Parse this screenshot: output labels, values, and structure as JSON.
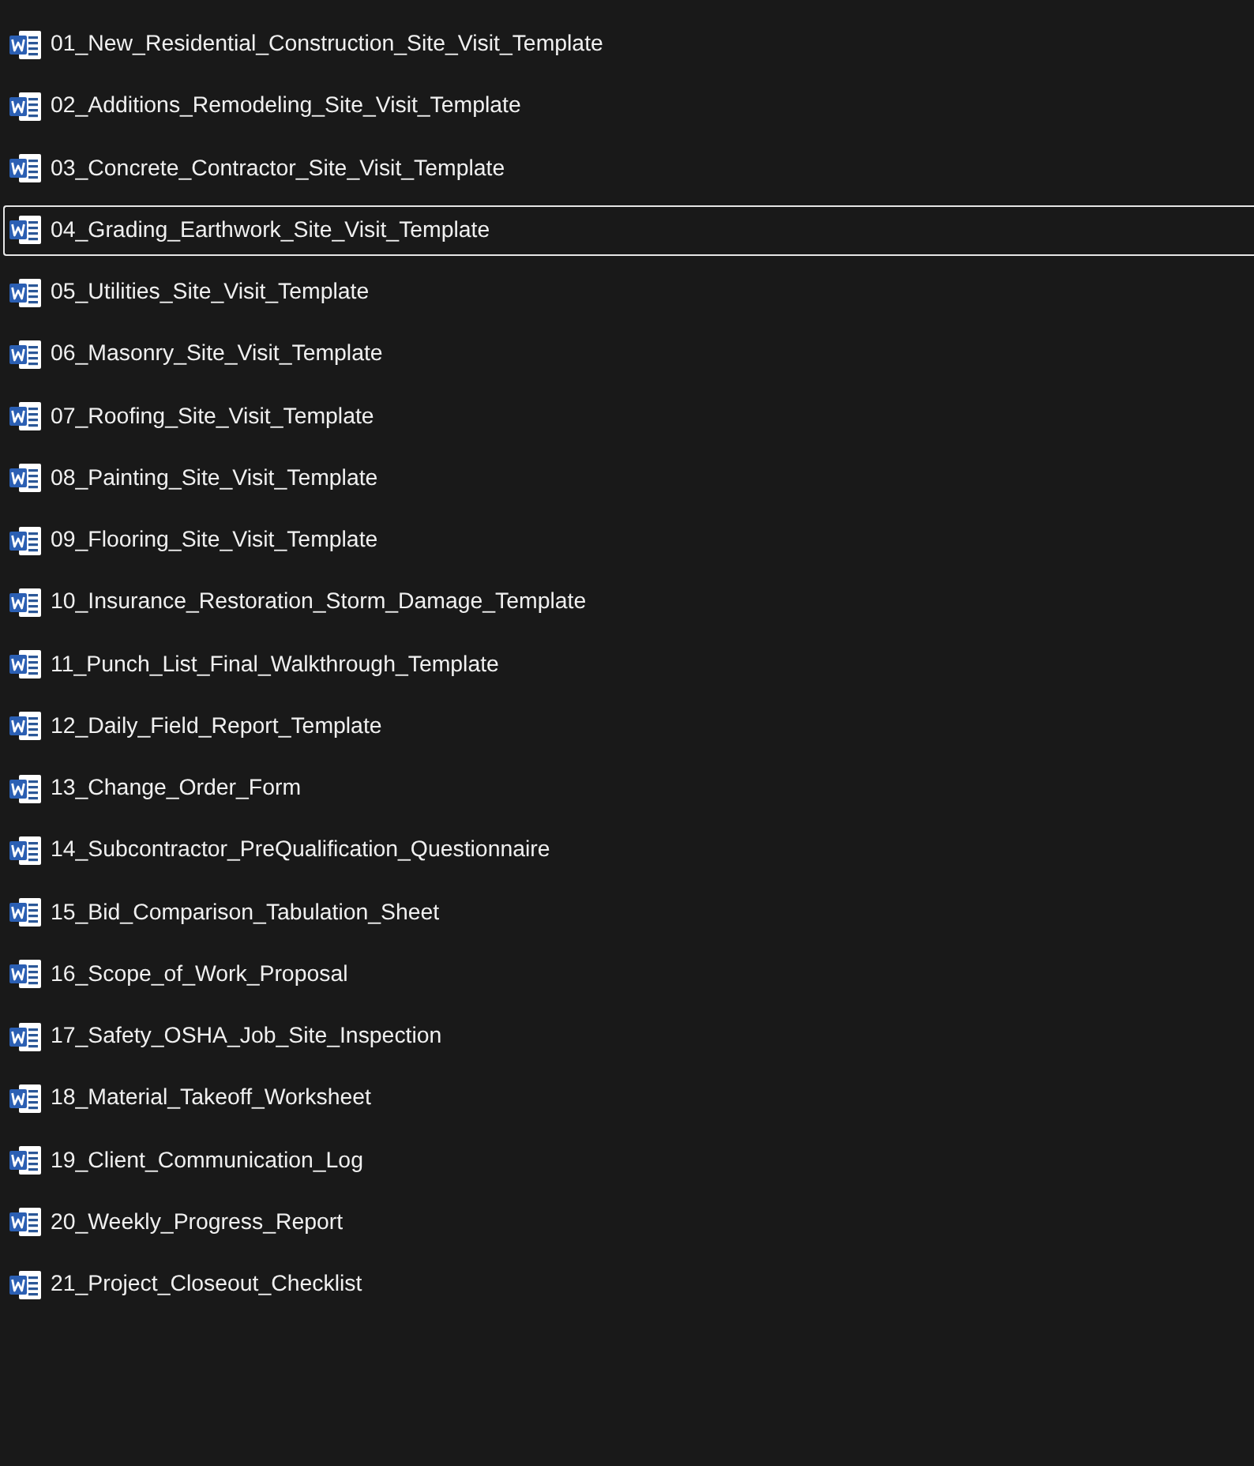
{
  "files": [
    {
      "name": "01_New_Residential_Construction_Site_Visit_Template",
      "focused": false
    },
    {
      "name": "02_Additions_Remodeling_Site_Visit_Template",
      "focused": false
    },
    {
      "name": "03_Concrete_Contractor_Site_Visit_Template",
      "focused": false
    },
    {
      "name": "04_Grading_Earthwork_Site_Visit_Template",
      "focused": true
    },
    {
      "name": "05_Utilities_Site_Visit_Template",
      "focused": false
    },
    {
      "name": "06_Masonry_Site_Visit_Template",
      "focused": false
    },
    {
      "name": "07_Roofing_Site_Visit_Template",
      "focused": false
    },
    {
      "name": "08_Painting_Site_Visit_Template",
      "focused": false
    },
    {
      "name": "09_Flooring_Site_Visit_Template",
      "focused": false
    },
    {
      "name": "10_Insurance_Restoration_Storm_Damage_Template",
      "focused": false
    },
    {
      "name": "11_Punch_List_Final_Walkthrough_Template",
      "focused": false
    },
    {
      "name": "12_Daily_Field_Report_Template",
      "focused": false
    },
    {
      "name": "13_Change_Order_Form",
      "focused": false
    },
    {
      "name": "14_Subcontractor_PreQualification_Questionnaire",
      "focused": false
    },
    {
      "name": "15_Bid_Comparison_Tabulation_Sheet",
      "focused": false
    },
    {
      "name": "16_Scope_of_Work_Proposal",
      "focused": false
    },
    {
      "name": "17_Safety_OSHA_Job_Site_Inspection",
      "focused": false
    },
    {
      "name": "18_Material_Takeoff_Worksheet",
      "focused": false
    },
    {
      "name": "19_Client_Communication_Log",
      "focused": false
    },
    {
      "name": "20_Weekly_Progress_Report",
      "focused": false
    },
    {
      "name": "21_Project_Closeout_Checklist",
      "focused": false
    }
  ]
}
